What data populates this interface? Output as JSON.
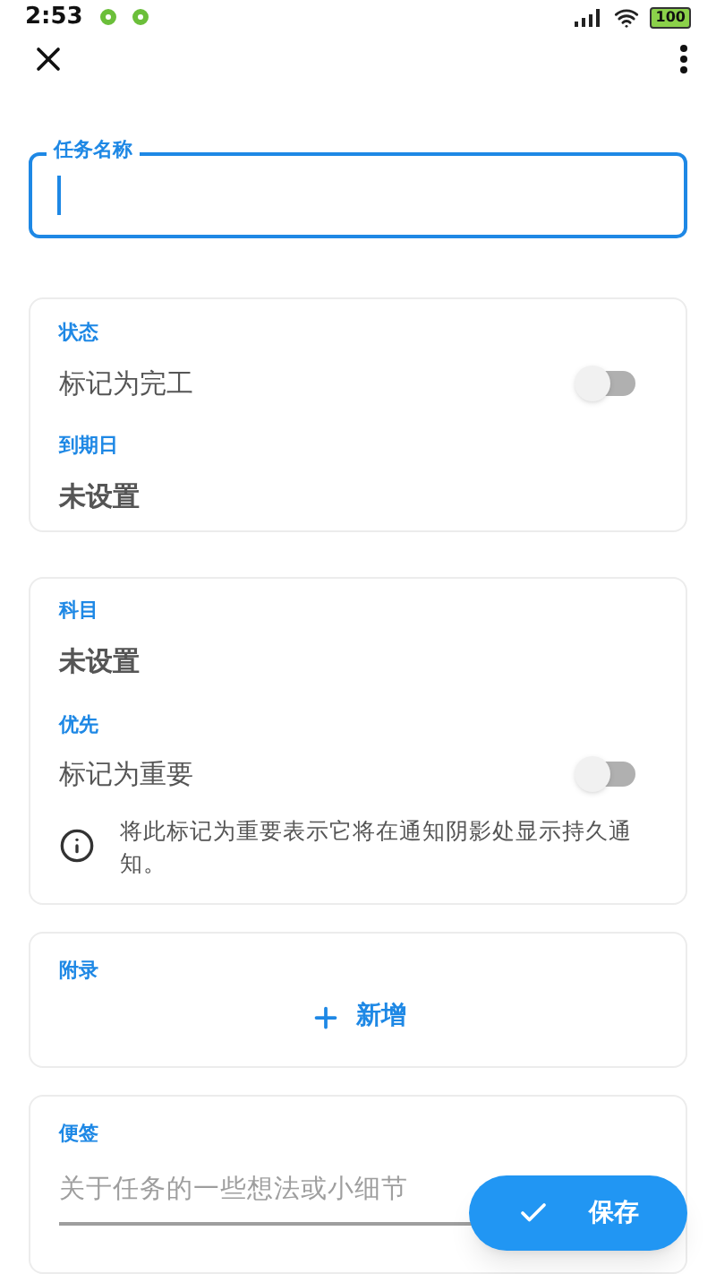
{
  "status_bar": {
    "time": "2:53",
    "battery": "100"
  },
  "title_field": {
    "label": "任务名称",
    "focused": true
  },
  "status_card": {
    "label": "状态",
    "toggle": {
      "label": "标记为完工",
      "on": false
    },
    "due_label": "到期日",
    "due_value": "未设置"
  },
  "subject_card": {
    "label": "科目",
    "value": "未设置",
    "priority_label": "优先",
    "toggle": {
      "label": "标记为重要",
      "on": false
    },
    "info": "将此标记为重要表示它将在通知阴影处显示持久通知。"
  },
  "attachments_card": {
    "label": "附录",
    "add_button": "新增"
  },
  "notes_card": {
    "label": "便签",
    "placeholder": "关于任务的一些想法或小细节"
  },
  "save_button": "保存"
}
